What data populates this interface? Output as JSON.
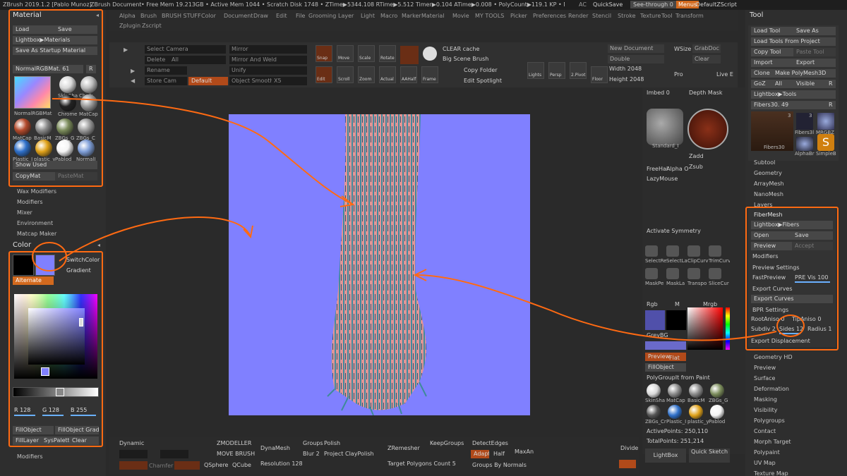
{
  "titlebar": {
    "app": "ZBrush 2019.1.2 [Pablo Munoz]",
    "doc": "ZBrush Document",
    "stats": "• Free Mem 19.213GB • Active Mem 1044 • Scratch Disk 1748 • ZTime▶5344.108 RTime▶5.512 Timer▶0.104 ATime▶0.008 • PolyCount▶119.1 KP • MeshCount▶1",
    "ac": "AC",
    "quicksave": "QuickSave",
    "seethrough": "See-through 0",
    "menus": "Menus",
    "script": "DefaultZScript"
  },
  "menus": [
    "Alpha",
    "Brush",
    "BRUSH STUFF",
    "Color",
    "Document",
    "Draw",
    "Edit",
    "File",
    "Grooming",
    "Layer",
    "Light",
    "Macro",
    "Marker",
    "Material",
    "Movie",
    "MY TOOLS",
    "Picker",
    "Preferences",
    "Render",
    "Stencil",
    "Stroke",
    "Texture",
    "Tool",
    "Transform"
  ],
  "submenus": [
    "Zplugin",
    "Zscript"
  ],
  "material_panel": {
    "title": "Material",
    "load": "Load",
    "save": "Save",
    "lightbox": "Lightbox▶Materials",
    "save_startup": "Save As Startup Material",
    "current": "NormalRGBMat. 61",
    "r": "R",
    "current_name": "NormalRGBMat",
    "swatches": [
      {
        "name": "SkinSha",
        "color": "#d9d9d9"
      },
      {
        "name": "Chalk",
        "color": "#bdbdbd"
      },
      {
        "name": "Chrome",
        "color": "#222222"
      },
      {
        "name": "MatCap",
        "color": "#9a9a9a"
      },
      {
        "name": "MatCap",
        "color": "#b34a2c"
      },
      {
        "name": "BasicM",
        "color": "#8a8a8a"
      },
      {
        "name": "ZBGs_G",
        "color": "#7a8b5a"
      },
      {
        "name": "ZBGs_C",
        "color": "#9c9c9c"
      },
      {
        "name": "Plastic_I",
        "color": "#2f70c9"
      },
      {
        "name": "plastic_y",
        "color": "#e0a21a"
      },
      {
        "name": "Pablod",
        "color": "#f5f5f5"
      },
      {
        "name": "NormalI",
        "color": "#7f9fd8"
      }
    ],
    "show_used": "Show Used",
    "copymat": "CopyMat",
    "pastemat": "PasteMat"
  },
  "left_menu": [
    "Wax Modifiers",
    "Modifiers",
    "Mixer",
    "Environment",
    "Matcap Maker"
  ],
  "color_panel": {
    "title": "Color",
    "switch": "SwitchColor",
    "gradient": "Gradient",
    "alternate": "Alternate",
    "r": "R 128",
    "g": "G 128",
    "b": "B 255",
    "fillobject": "FillObject",
    "fillgrad": "FillObject Grad",
    "filllayer": "FillLayer",
    "syspalette": "SysPalette",
    "clear": "Clear",
    "primary": "#000000",
    "secondary": "#8080ff"
  },
  "left_bottom": "Modifiers",
  "shelf": {
    "select_camera": "Select Camera",
    "delete": "Delete",
    "all": "All",
    "rename": "Rename",
    "store_cam": "Store Cam",
    "default": "Default",
    "mirror": "Mirror",
    "mirror_weld": "Mirror And Weld",
    "unify": "Unify",
    "obj_smooth": "Object Smooth",
    "x5": "X5",
    "clear_cache": "CLEAR cache",
    "big_scene": "Big Scene Brush",
    "copy_folder": "Copy Folder",
    "edit_spotlight": "Edit Spotlight",
    "new_doc": "New Document",
    "double": "Double",
    "width": "Width 2048",
    "height": "Height 2048",
    "wsize": "WSize",
    "grabdoc": "GrabDoc",
    "clear": "Clear",
    "pro": "Pro",
    "live": "Live E",
    "icons": [
      "Snap",
      "Move",
      "Scale",
      "Rotate",
      "",
      "Lights",
      "Tamp",
      "2.Pivot",
      "",
      "Edit",
      "Scroll",
      "Zoom",
      "Actual",
      "AAHalf",
      "Frame",
      "",
      "Persp",
      "Floor"
    ]
  },
  "canvas": {
    "bg": "#8080ff"
  },
  "mid_right": {
    "imbed": "Imbed 0",
    "depth_mask": "Depth Mask",
    "brush_name": "Standard_I",
    "zadd": "Zadd",
    "zsub": "Zsub",
    "freehair": "FreeHai",
    "alpha": "Alpha O",
    "lazymouse": "LazyMouse",
    "activate_sym": "Activate Symmetry",
    "tools": [
      "SelectRe",
      "SelectLa",
      "ClipCurv",
      "TrimCurv",
      "MaskPe",
      "MaskLa",
      "Transpo",
      "SliceCur"
    ],
    "rgb": "Rgb",
    "m": "M",
    "mrgb": "Mrgb",
    "grey": "GreyBG",
    "preview": "Preview",
    "flat": "Flat",
    "fillobj": "FillObject",
    "polygroup": "PolyGroupIt from Paint",
    "mats": [
      "SkinSha",
      "MatCap",
      "BasicM",
      "ZBGs_G",
      "ZBGs_Cr",
      "Plastic_I",
      "plastic_y",
      "Pablod"
    ],
    "active_points": "ActivePoints: 250,110",
    "total_points": "TotalPoints: 251,214",
    "lightbox": "LightBox",
    "quick_sketch": "Quick Sketch"
  },
  "tool_panel": {
    "title": "Tool",
    "load_tool": "Load Tool",
    "save_as": "Save As",
    "load_project": "Load Tools From Project",
    "copy_tool": "Copy Tool",
    "paste_tool": "Paste Tool",
    "import": "Import",
    "export": "Export",
    "clone": "Clone",
    "make_poly": "Make PolyMesh3D",
    "goz": "GoZ",
    "all": "All",
    "visible": "Visible",
    "r": "R",
    "lightbox_tools": "Lightbox▶Tools",
    "fibers": "Fibers30. 49",
    "r2": "R",
    "thumbs": [
      "Fibers30",
      "Fibers3l",
      "MRGBZ",
      "AlphaBr",
      "SimpleB"
    ],
    "count": "3",
    "count2": "3",
    "sections": [
      "Subtool",
      "Geometry",
      "ArrayMesh",
      "NanoMesh",
      "Layers"
    ],
    "fibermesh": {
      "title": "FiberMesh",
      "lightbox": "Lightbox▶Fibers",
      "open": "Open",
      "save": "Save",
      "preview": "Preview",
      "accept": "Accept",
      "modifiers": "Modifiers",
      "preview_settings": "Preview Settings",
      "fastpreview": "FastPreview",
      "pre_vis": "PRE Vis 100",
      "export_curves_h": "Export Curves",
      "export_curves": "Export Curves",
      "bpr": "BPR Settings",
      "rootaniso": "RootAniso 0",
      "tipaniso": "TipAniso 0",
      "subdiv": "Subdiv 2",
      "sides": "Sides 12",
      "radius": "Radius 1",
      "export_disp": "Export Displacement"
    },
    "sections2": [
      "Geometry HD",
      "Preview",
      "Surface",
      "Deformation",
      "Masking",
      "Visibility",
      "Polygroups",
      "Contact",
      "Morph Target",
      "Polypaint",
      "UV Map",
      "Texture Map"
    ]
  },
  "bottom_shelf": {
    "dynamic": "Dynamic",
    "zmodeler": "ZMODELLER",
    "move_brush": "MOVE BRUSH",
    "qsphere": "QSphere",
    "qcube": "QCube",
    "dynamesh": "DynaMesh",
    "resolution": "Resolution 128",
    "groups": "Groups",
    "polish": "Polish",
    "blur": "Blur 2",
    "project": "Project",
    "claypolish": "ClayPolish",
    "zremesher": "ZRemesher",
    "target": "Target Polygons Count 5",
    "keepgroups": "KeepGroups",
    "detectedges": "DetectEdges",
    "adapt": "Adapt",
    "half": "Half",
    "maxang": "MaxAn",
    "groups_normals": "Groups By Normals",
    "divide": "Divide",
    "dim_labels": [
      "Chamfer",
      "Claws"
    ]
  },
  "accent": "#ff6a12"
}
